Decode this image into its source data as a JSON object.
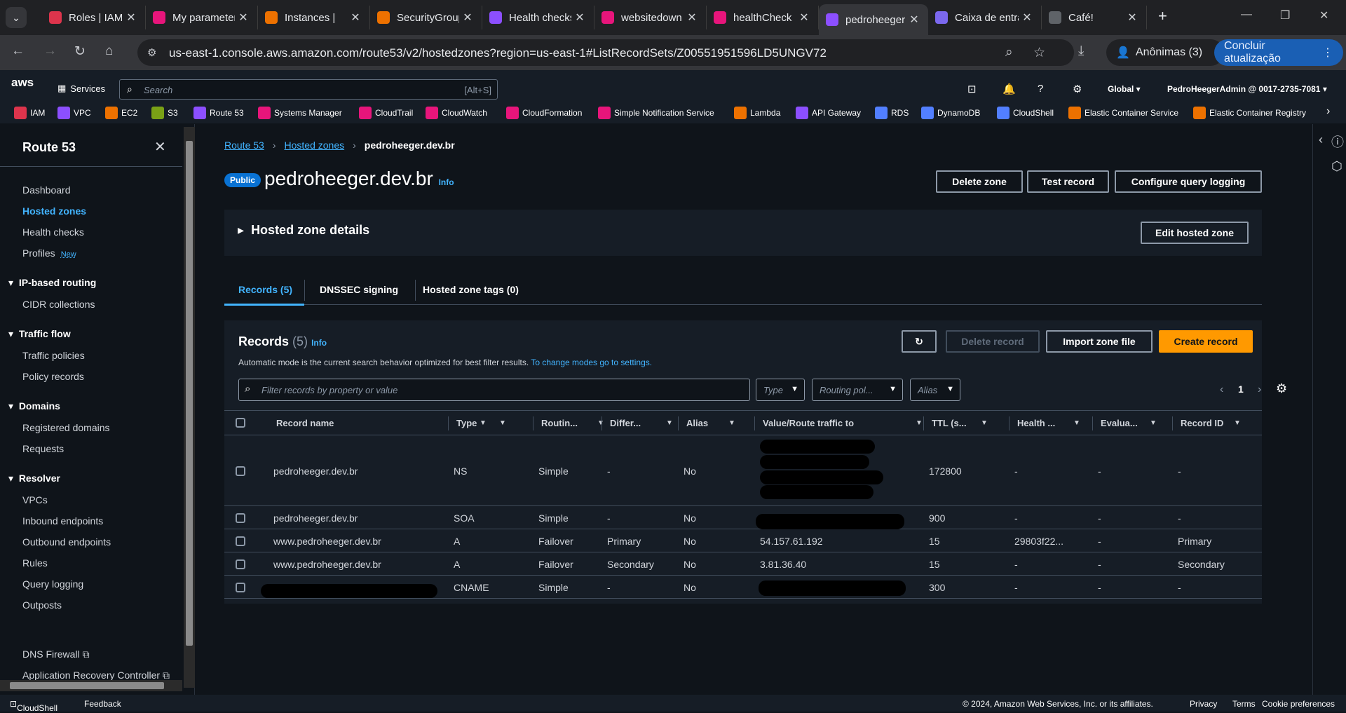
{
  "browser": {
    "tabs": [
      {
        "label": "Roles | IAM",
        "color": "#dd344c",
        "icon": "iam-icon"
      },
      {
        "label": "My parameters",
        "color": "#e7157b",
        "icon": "systems-manager-icon"
      },
      {
        "label": "Instances |",
        "color": "#ed7100",
        "icon": "ec2-icon"
      },
      {
        "label": "SecurityGroups",
        "color": "#ed7100",
        "icon": "ec2-icon"
      },
      {
        "label": "Health checks",
        "color": "#8c4fff",
        "icon": "route53-icon"
      },
      {
        "label": "websitedown",
        "color": "#e7157b",
        "icon": "cloudwatch-icon"
      },
      {
        "label": "healthCheck",
        "color": "#e7157b",
        "icon": "cloudwatch-icon"
      },
      {
        "label": "pedroheeger",
        "color": "#8c4fff",
        "icon": "route53-icon",
        "active": true
      },
      {
        "label": "Caixa de entrada",
        "color": "#7b68ee",
        "icon": "mail-icon"
      },
      {
        "label": "Café!",
        "color": "#5f6368",
        "icon": "globe-icon"
      }
    ],
    "url": "us-east-1.console.aws.amazon.com/route53/v2/hostedzones?region=us-east-1#ListRecordSets/Z00551951596LD5UNGV72",
    "incognito_label": "Anônimas (3)",
    "update_label": "Concluir atualização"
  },
  "aws": {
    "logo": "aws",
    "services_label": "Services",
    "search_placeholder": "Search",
    "search_shortcut": "[Alt+S]",
    "region": "Global",
    "account": "PedroHeegerAdmin @ 0017-2735-7081",
    "favorites": [
      {
        "label": "IAM",
        "color": "#dd344c"
      },
      {
        "label": "VPC",
        "color": "#8c4fff"
      },
      {
        "label": "EC2",
        "color": "#ed7100"
      },
      {
        "label": "S3",
        "color": "#7aa116"
      },
      {
        "label": "Route 53",
        "color": "#8c4fff"
      },
      {
        "label": "Systems Manager",
        "color": "#e7157b"
      },
      {
        "label": "CloudTrail",
        "color": "#e7157b"
      },
      {
        "label": "CloudWatch",
        "color": "#e7157b"
      },
      {
        "label": "CloudFormation",
        "color": "#e7157b"
      },
      {
        "label": "Simple Notification Service",
        "color": "#e7157b"
      },
      {
        "label": "Lambda",
        "color": "#ed7100"
      },
      {
        "label": "API Gateway",
        "color": "#8c4fff"
      },
      {
        "label": "RDS",
        "color": "#527fff"
      },
      {
        "label": "DynamoDB",
        "color": "#527fff"
      },
      {
        "label": "CloudShell",
        "color": "#527fff"
      },
      {
        "label": "Elastic Container Service",
        "color": "#ed7100"
      },
      {
        "label": "Elastic Container Registry",
        "color": "#ed7100"
      }
    ]
  },
  "sidebar": {
    "title": "Route 53",
    "links": {
      "dashboard": "Dashboard",
      "hosted_zones": "Hosted zones",
      "health_checks": "Health checks",
      "profiles": "Profiles",
      "profiles_badge": "New",
      "cidr": "CIDR collections",
      "traffic_policies": "Traffic policies",
      "policy_records": "Policy records",
      "registered_domains": "Registered domains",
      "requests": "Requests",
      "vpcs": "VPCs",
      "inbound": "Inbound endpoints",
      "outbound": "Outbound endpoints",
      "rules": "Rules",
      "query_logging": "Query logging",
      "outposts": "Outposts",
      "dns_firewall": "DNS Firewall",
      "arc": "Application Recovery Controller"
    },
    "sections": {
      "ip_routing": "IP-based routing",
      "traffic_flow": "Traffic flow",
      "domains": "Domains",
      "resolver": "Resolver"
    }
  },
  "main": {
    "breadcrumb": {
      "root": "Route 53",
      "parent": "Hosted zones",
      "current": "pedroheeger.dev.br"
    },
    "badge": "Public",
    "zone_name": "pedroheeger.dev.br",
    "info": "Info",
    "buttons": {
      "delete_zone": "Delete zone",
      "test_record": "Test record",
      "configure_logging": "Configure query logging",
      "edit_zone": "Edit hosted zone"
    },
    "details_title": "Hosted zone details",
    "tabs": {
      "records": "Records (5)",
      "dnssec": "DNSSEC signing",
      "tags": "Hosted zone tags (0)"
    },
    "records": {
      "title": "Records",
      "count": "(5)",
      "description": "Automatic mode is the current search behavior optimized for best filter results.",
      "settings_link": "To change modes go to settings.",
      "buttons": {
        "delete": "Delete record",
        "import": "Import zone file",
        "create": "Create record"
      },
      "filter_placeholder": "Filter records by property or value",
      "filters": {
        "type": "Type",
        "routing": "Routing pol...",
        "alias": "Alias"
      },
      "page": "1",
      "columns": [
        "Record name",
        "Type",
        "Routin...",
        "Differ...",
        "Alias",
        "Value/Route traffic to",
        "TTL (s...",
        "Health ...",
        "Evalua...",
        "Record ID"
      ],
      "rows": [
        {
          "name": "pedroheeger.dev.br",
          "type": "NS",
          "routing": "Simple",
          "diff": "-",
          "alias": "No",
          "value": "",
          "ttl": "172800",
          "health": "-",
          "eval": "-",
          "id": "-"
        },
        {
          "name": "pedroheeger.dev.br",
          "type": "SOA",
          "routing": "Simple",
          "diff": "-",
          "alias": "No",
          "value": "",
          "ttl": "900",
          "health": "-",
          "eval": "-",
          "id": "-"
        },
        {
          "name": "www.pedroheeger.dev.br",
          "type": "A",
          "routing": "Failover",
          "diff": "Primary",
          "alias": "No",
          "value": "54.157.61.192",
          "ttl": "15",
          "health": "29803f22...",
          "eval": "-",
          "id": "Primary"
        },
        {
          "name": "www.pedroheeger.dev.br",
          "type": "A",
          "routing": "Failover",
          "diff": "Secondary",
          "alias": "No",
          "value": "3.81.36.40",
          "ttl": "15",
          "health": "-",
          "eval": "-",
          "id": "Secondary"
        },
        {
          "name": "",
          "type": "CNAME",
          "routing": "Simple",
          "diff": "-",
          "alias": "No",
          "value": "",
          "ttl": "300",
          "health": "-",
          "eval": "-",
          "id": "-"
        }
      ]
    }
  },
  "footer": {
    "cloudshell": "CloudShell",
    "feedback": "Feedback",
    "copyright": "© 2024, Amazon Web Services, Inc. or its affiliates.",
    "privacy": "Privacy",
    "terms": "Terms",
    "cookies": "Cookie preferences"
  }
}
